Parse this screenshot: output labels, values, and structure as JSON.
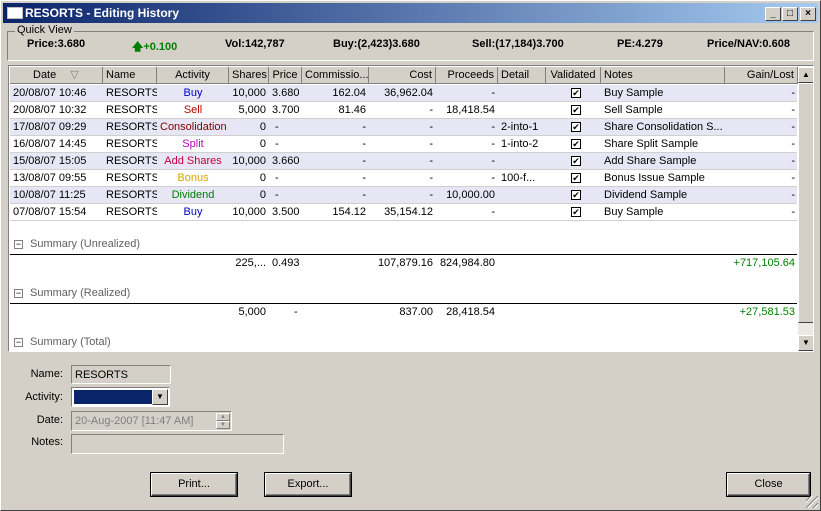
{
  "window": {
    "title": "RESORTS - Editing History"
  },
  "quick_view": {
    "label": "Quick View",
    "price": "Price:3.680",
    "change": "+0.100",
    "vol": "Vol:142,787",
    "buy": "Buy:(2,423)3.680",
    "sell": "Sell:(17,184)3.700",
    "pe": "PE:4.279",
    "price_nav": "Price/NAV:0.608",
    "up_color": "#008000"
  },
  "columns": [
    "Date",
    "Name",
    "Activity",
    "Shares",
    "Price",
    "Commissio...",
    "Cost",
    "Proceeds",
    "Detail",
    "Validated",
    "Notes",
    "Gain/Lost"
  ],
  "rows": [
    {
      "date": "20/08/07 10:46",
      "name": "RESORTS",
      "activity": "Buy",
      "activity_color": "#0000c0",
      "shares": "10,000",
      "price": "3.680",
      "commission": "162.04",
      "cost": "36,962.04",
      "proceeds": "-",
      "detail": "",
      "validated": "✔",
      "notes": "Buy Sample",
      "gain": "-"
    },
    {
      "date": "20/08/07 10:32",
      "name": "RESORTS",
      "activity": "Sell",
      "activity_color": "#c00000",
      "shares": "5,000",
      "price": "3.700",
      "commission": "81.46",
      "cost": "-",
      "proceeds": "18,418.54",
      "detail": "",
      "validated": "✔",
      "notes": "Sell Sample",
      "gain": "-"
    },
    {
      "date": "17/08/07 09:29",
      "name": "RESORTS",
      "activity": "Consolidation",
      "activity_color": "#800000",
      "shares": "0",
      "price": "-",
      "commission": "-",
      "cost": "-",
      "proceeds": "-",
      "detail": "2-into-1",
      "validated": "✔",
      "notes": "Share Consolidation S...",
      "gain": "-"
    },
    {
      "date": "16/08/07 14:45",
      "name": "RESORTS",
      "activity": "Split",
      "activity_color": "#c000c0",
      "shares": "0",
      "price": "-",
      "commission": "-",
      "cost": "-",
      "proceeds": "-",
      "detail": "1-into-2",
      "validated": "✔",
      "notes": "Share Split Sample",
      "gain": "-"
    },
    {
      "date": "15/08/07 15:05",
      "name": "RESORTS",
      "activity": "Add Shares",
      "activity_color": "#c00040",
      "shares": "10,000",
      "price": "3.660",
      "commission": "-",
      "cost": "-",
      "proceeds": "-",
      "detail": "",
      "validated": "✔",
      "notes": "Add Share Sample",
      "gain": "-"
    },
    {
      "date": "13/08/07 09:55",
      "name": "RESORTS",
      "activity": "Bonus",
      "activity_color": "#e0a000",
      "shares": "0",
      "price": "-",
      "commission": "-",
      "cost": "-",
      "proceeds": "-",
      "detail": "100-f...",
      "validated": "✔",
      "notes": "Bonus Issue Sample",
      "gain": "-"
    },
    {
      "date": "10/08/07 11:25",
      "name": "RESORTS",
      "activity": "Dividend",
      "activity_color": "#008000",
      "shares": "0",
      "price": "-",
      "commission": "-",
      "cost": "-",
      "proceeds": "10,000.00",
      "detail": "",
      "validated": "✔",
      "notes": "Dividend Sample",
      "gain": "-"
    },
    {
      "date": "07/08/07 15:54",
      "name": "RESORTS",
      "activity": "Buy",
      "activity_color": "#0000c0",
      "shares": "10,000",
      "price": "3.500",
      "commission": "154.12",
      "cost": "35,154.12",
      "proceeds": "-",
      "detail": "",
      "validated": "✔",
      "notes": "Buy Sample",
      "gain": "-"
    }
  ],
  "summary_unrealized": {
    "label": "Summary (Unrealized)",
    "shares": "225,...",
    "price": "0.493",
    "cost": "107,879.16",
    "proceeds": "824,984.80",
    "gain": "+717,105.64"
  },
  "summary_realized": {
    "label": "Summary (Realized)",
    "shares": "5,000",
    "price": "-",
    "cost": "837.00",
    "proceeds": "28,418.54",
    "gain": "+27,581.53"
  },
  "summary_total": {
    "label": "Summary (Total)"
  },
  "form": {
    "name_label": "Name:",
    "name_value": "RESORTS",
    "activity_label": "Activity:",
    "date_label": "Date:",
    "date_value": "20-Aug-2007 [11:47 AM]",
    "notes_label": "Notes:",
    "notes_value": ""
  },
  "buttons": {
    "print": "Print...",
    "export": "Export...",
    "close": "Close"
  }
}
